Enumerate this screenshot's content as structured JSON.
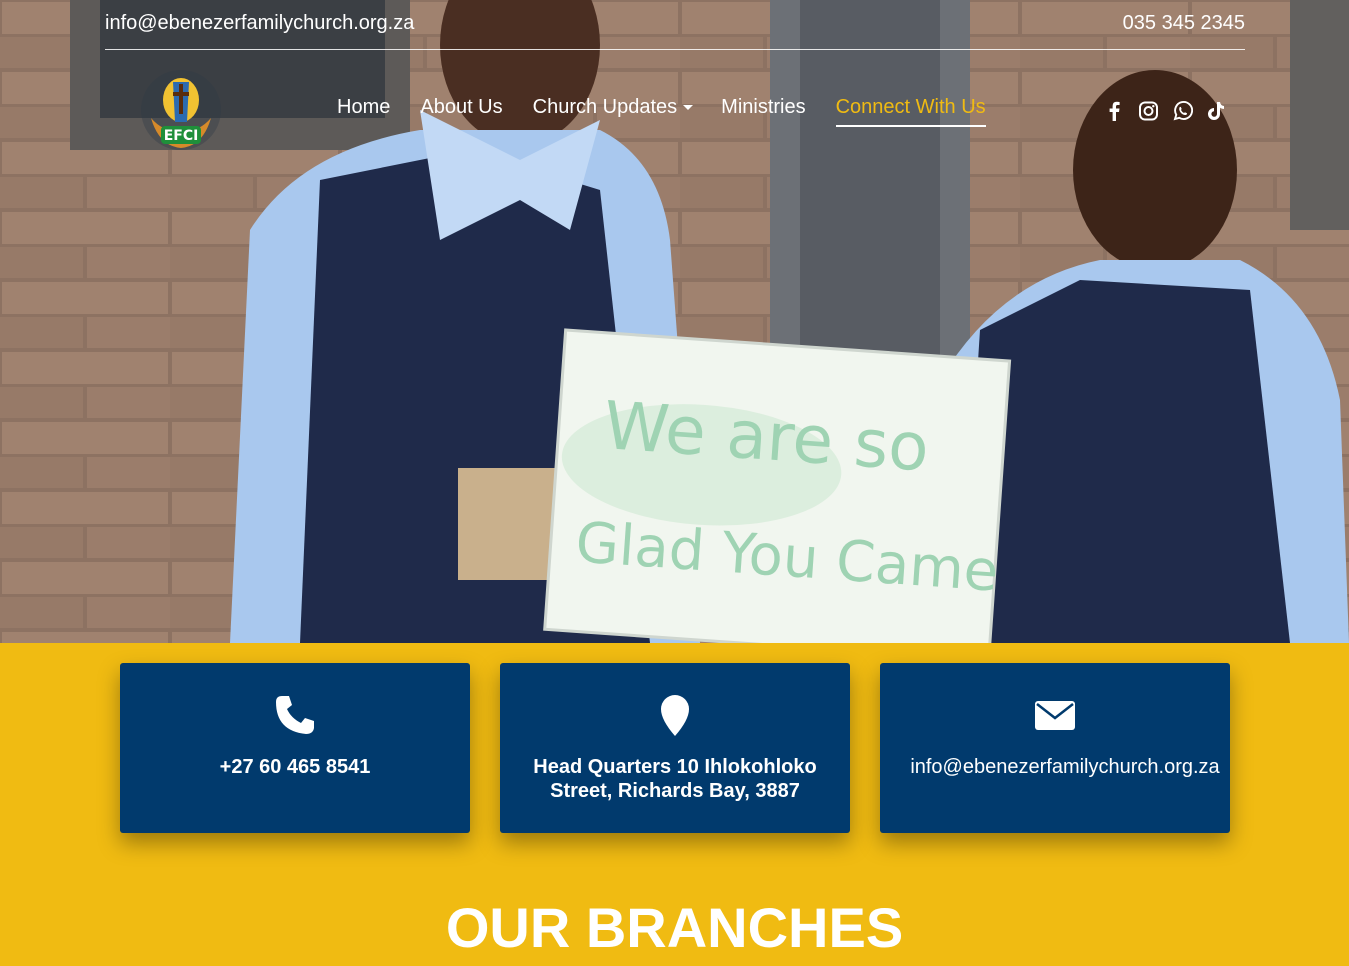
{
  "topbar": {
    "email": "info@ebenezerfamilychurch.org.za",
    "phone": "035 345 2345"
  },
  "logo": {
    "text": "EFCI",
    "ring_text": "EBENEZER FAMILY CHURCH INTERNATIONAL"
  },
  "nav": {
    "items": [
      {
        "label": "Home"
      },
      {
        "label": "About Us"
      },
      {
        "label": "Church Updates"
      },
      {
        "label": "Ministries"
      },
      {
        "label": "Connect With Us"
      }
    ]
  },
  "social": [
    "facebook-icon",
    "instagram-icon",
    "whatsapp-icon",
    "tiktok-icon"
  ],
  "hero": {
    "sign_line1": "We are so",
    "sign_line2": "Glad You Came"
  },
  "contact_cards": [
    {
      "icon": "phone-icon",
      "text": "+27 60 465 8541"
    },
    {
      "icon": "location-pin-icon",
      "text": "Head Quarters 10 Ihlokohloko Street, Richards Bay, 3887"
    },
    {
      "icon": "envelope-icon",
      "text": "info@ebenezerfamilychurch.org.za"
    }
  ],
  "section_title": "OUR BRANCHES",
  "colors": {
    "navy": "#013a6d",
    "gold": "#f0bb12",
    "white": "#ffffff"
  }
}
